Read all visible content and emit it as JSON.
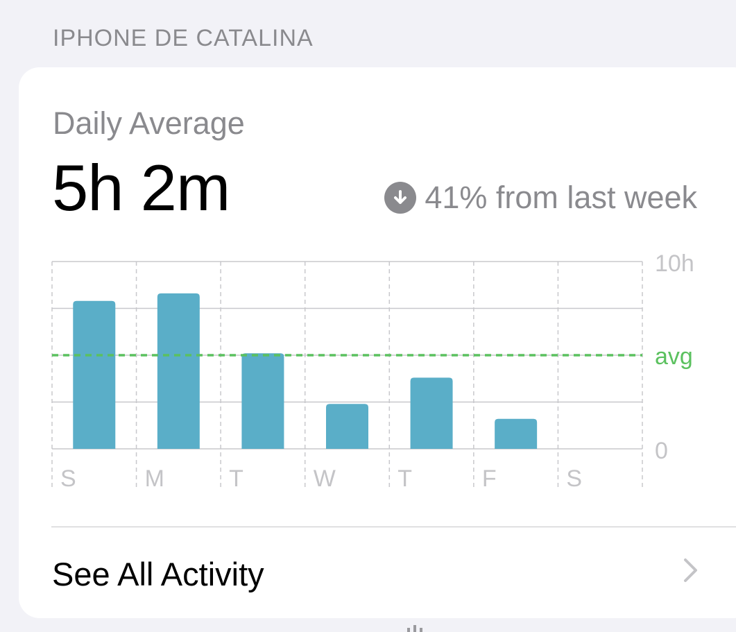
{
  "section_header": "IPHONE DE CATALINA",
  "card": {
    "daily_label": "Daily Average",
    "daily_value": "5h 2m",
    "change_text": "41% from last week",
    "change_direction": "down",
    "see_all_label": "See All Activity"
  },
  "colors": {
    "bar": "#5aaec8",
    "avg_line": "#5bc15f",
    "grid": "#c8c8cc",
    "secondary_text": "#8a8a8e",
    "background": "#f2f2f7"
  },
  "chart_data": {
    "type": "bar",
    "categories": [
      "S",
      "M",
      "T",
      "W",
      "T",
      "F",
      "S"
    ],
    "values": [
      7.9,
      8.3,
      5.1,
      2.4,
      3.8,
      1.6,
      0
    ],
    "ylim": [
      0,
      10
    ],
    "y_tick_labels": [
      "10h",
      "avg",
      "0"
    ],
    "avg_value": 5.0,
    "avg_label": "avg",
    "grid": true
  }
}
